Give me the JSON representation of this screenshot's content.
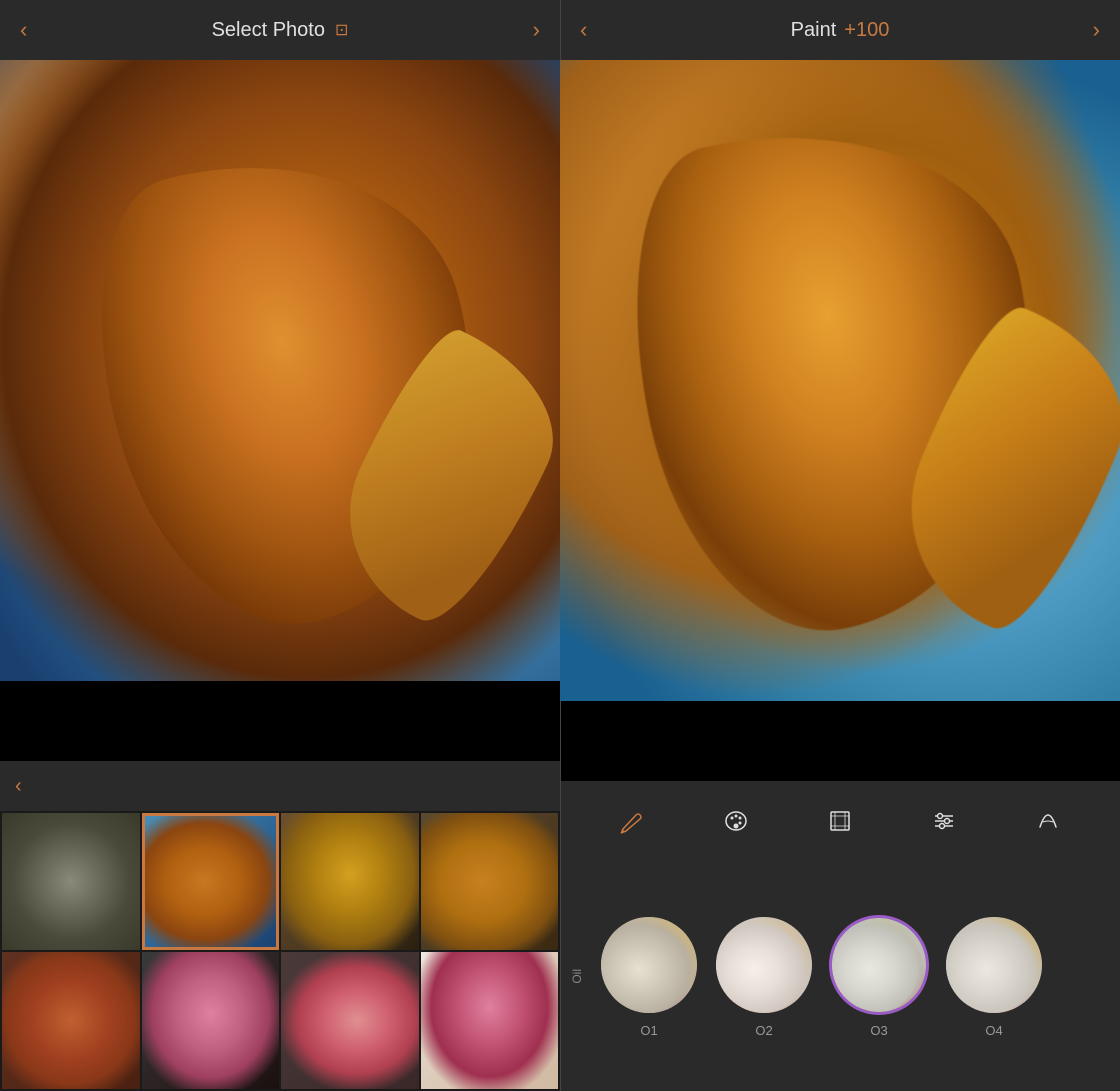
{
  "left_panel": {
    "header": {
      "title": "Select Photo",
      "back_label": "‹",
      "forward_label": "›"
    },
    "strip_header": {
      "back_label": "‹"
    },
    "thumbnails": [
      {
        "id": 1,
        "label": "sticks",
        "selected": false
      },
      {
        "id": 2,
        "label": "petal-blue",
        "selected": true
      },
      {
        "id": 3,
        "label": "yellow-leaves",
        "selected": false
      },
      {
        "id": 4,
        "label": "brown-leaves",
        "selected": false
      },
      {
        "id": 5,
        "label": "orange-texture",
        "selected": false
      },
      {
        "id": 6,
        "label": "pink-flower",
        "selected": false
      },
      {
        "id": 7,
        "label": "rose-close",
        "selected": false
      },
      {
        "id": 8,
        "label": "pink-striped",
        "selected": false
      }
    ]
  },
  "right_panel": {
    "header": {
      "title": "Paint",
      "value": "+100",
      "back_label": "‹",
      "forward_label": "›"
    },
    "toolbar": {
      "brush_label": "brush",
      "palette_label": "palette",
      "canvas_label": "canvas",
      "sliders_label": "sliders",
      "text_label": "text"
    },
    "style_strip": {
      "category_label": "Oil",
      "styles": [
        {
          "id": "O1",
          "label": "O1",
          "selected": false
        },
        {
          "id": "O2",
          "label": "O2",
          "selected": false
        },
        {
          "id": "O3",
          "label": "O3",
          "selected": true
        },
        {
          "id": "O4",
          "label": "O4",
          "selected": false
        }
      ]
    }
  },
  "colors": {
    "accent": "#c87941",
    "selected_border": "#9b5bc7",
    "bg_dark": "#1a1a1a",
    "bg_medium": "#2a2a2a",
    "text_primary": "#e0e0e0",
    "text_muted": "#999999"
  }
}
